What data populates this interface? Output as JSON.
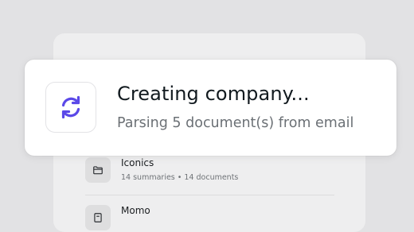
{
  "toast": {
    "icon": "refresh-icon",
    "icon_color": "#5b49e8",
    "title": "Creating company...",
    "subtitle": "Parsing 5 document(s) from email"
  },
  "companies": [
    {
      "icon": "folder-icon",
      "name": "Iconics",
      "meta": "14 summaries • 14 documents"
    },
    {
      "icon": "document-icon",
      "name": "Momo"
    }
  ]
}
